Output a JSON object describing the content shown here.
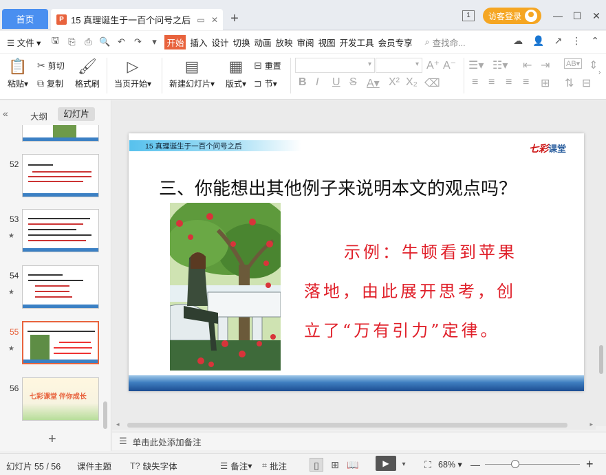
{
  "titlebar": {
    "home_tab": "首页",
    "doc_tab": "15 真理诞生于一百个问号之后",
    "doc_icon": "P",
    "visitor_login": "访客登录",
    "page_indicator": "1"
  },
  "menu": {
    "file": "文件",
    "items": [
      "开始",
      "插入",
      "设计",
      "切换",
      "动画",
      "放映",
      "审阅",
      "视图",
      "开发工具",
      "会员专享"
    ],
    "search_placeholder": "查找命..."
  },
  "ribbon": {
    "paste": "粘贴",
    "cut": "剪切",
    "copy": "复制",
    "format_painter": "格式刷",
    "from_current": "当页开始",
    "new_slide": "新建幻灯片",
    "layout": "版式",
    "reset": "重置",
    "section": "节"
  },
  "left_panel": {
    "outline_tab": "大纲",
    "slides_tab": "幻灯片",
    "slides": [
      {
        "num": "52",
        "star": false
      },
      {
        "num": "53",
        "star": true
      },
      {
        "num": "54",
        "star": true
      },
      {
        "num": "55",
        "star": true,
        "selected": true
      },
      {
        "num": "56",
        "star": false
      }
    ],
    "thumb56_text": "七彩课堂 伴你成长"
  },
  "slide": {
    "header": "15 真理诞生于一百个问号之后",
    "logo_script": "七彩",
    "logo_text": "课堂",
    "title": "三、你能想出其他例子来说明本文的观点吗？",
    "body_line1": "示例：牛顿看到苹果",
    "body_line2": "落地，由此展开思考，创",
    "body_line3": "立了“万有引力”定律。"
  },
  "notes": {
    "placeholder": "单击此处添加备注"
  },
  "status": {
    "slide_counter": "幻灯片 55 / 56",
    "theme": "课件主题",
    "missing_font": "缺失字体",
    "notes_btn": "备注",
    "comments_btn": "批注",
    "zoom": "68%"
  },
  "colors": {
    "accent_orange": "#e8633d",
    "home_blue": "#4a8ff0",
    "slide_red": "#e0202a"
  }
}
